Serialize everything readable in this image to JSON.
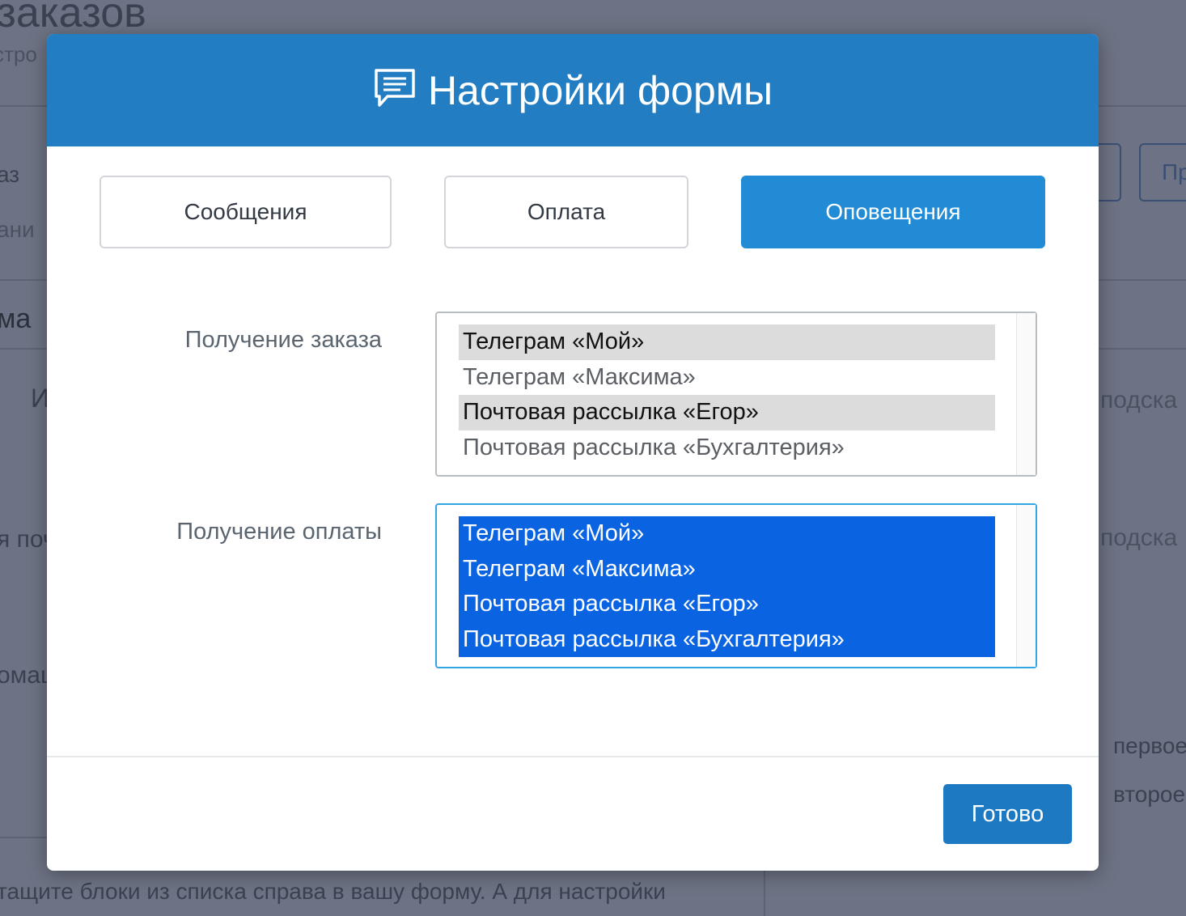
{
  "background": {
    "title_fragment": "заказов",
    "subtitle_fragment": "стро",
    "left_fragments": [
      "аз",
      "ани",
      "ма",
      "И",
      "я поч",
      "омац"
    ],
    "right_button_fragment": "Пр",
    "right_hint_1": "подска",
    "right_hint_2": "подска",
    "right_option_1": "первое",
    "right_option_2": "второе",
    "bottom_text": "тащите блоки из списка справа в вашу форму. А для настройки"
  },
  "modal": {
    "title": "Настройки формы",
    "icon": "chat-message-icon",
    "tabs": [
      {
        "label": "Сообщения",
        "active": false
      },
      {
        "label": "Оплата",
        "active": false
      },
      {
        "label": "Оповещения",
        "active": true
      }
    ],
    "fields": [
      {
        "label": "Получение заказа",
        "options": [
          {
            "label": "Телеграм «Мой»",
            "selected": true
          },
          {
            "label": "Телеграм «Максима»",
            "selected": false
          },
          {
            "label": "Почтовая рассылка «Егор»",
            "selected": true
          },
          {
            "label": "Почтовая рассылка «Бухгалтерия»",
            "selected": false
          }
        ]
      },
      {
        "label": "Получение оплаты",
        "options": [
          {
            "label": "Телеграм «Мой»",
            "selected": true
          },
          {
            "label": "Телеграм «Максима»",
            "selected": true
          },
          {
            "label": "Почтовая рассылка «Егор»",
            "selected": true
          },
          {
            "label": "Почтовая рассылка «Бухгалтерия»",
            "selected": true
          }
        ]
      }
    ],
    "done_label": "Готово"
  },
  "colors": {
    "header": "#237dc2",
    "active_tab": "#218bd6",
    "selection_focused": "#0a64e2",
    "selection_unfocused": "#dcdcdc",
    "done_button": "#1d7ac2"
  }
}
